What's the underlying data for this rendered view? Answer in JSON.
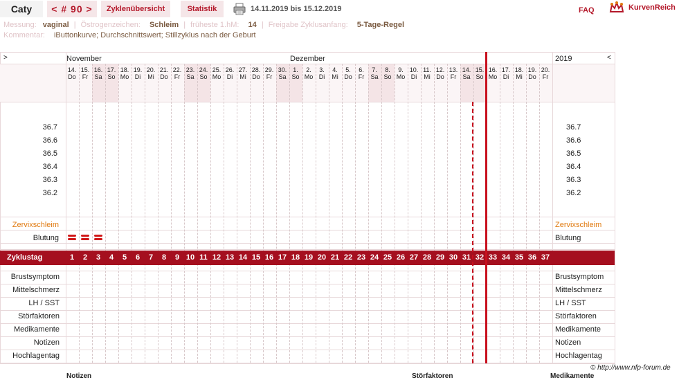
{
  "header": {
    "user_name": "Caty",
    "cycle_nav": "< # 90 >",
    "tab_overview": "Zyklenübersicht",
    "tab_stats": "Statistik",
    "date_range": "14.11.2019 bis 15.12.2019",
    "faq": "FAQ",
    "logo": "KurvenReich"
  },
  "info": {
    "messung_label": "Messung:",
    "messung_value": "vaginal",
    "oestrogen_label": "Östrogenzeichen:",
    "oestrogen_value": "Schleim",
    "fruehste_label": "früheste 1.hM:",
    "fruehste_value": "14",
    "freigabe_label": "Freigabe Zyklusanfang:",
    "freigabe_value": "5-Tage-Regel",
    "kommentar_label": "Kommentar:",
    "kommentar_value": "iButtonkurve; Durchschnittswert; Stillzyklus nach der Geburt"
  },
  "chart": {
    "nav_left": ">",
    "nav_right": "<",
    "month_nov": "November",
    "month_dez": "Dezember",
    "year": "2019",
    "days": [
      {
        "d": "14.",
        "w": "Do"
      },
      {
        "d": "15.",
        "w": "Fr"
      },
      {
        "d": "16.",
        "w": "Sa"
      },
      {
        "d": "17.",
        "w": "So"
      },
      {
        "d": "18.",
        "w": "Mo"
      },
      {
        "d": "19.",
        "w": "Di"
      },
      {
        "d": "20.",
        "w": "Mi"
      },
      {
        "d": "21.",
        "w": "Do"
      },
      {
        "d": "22.",
        "w": "Fr"
      },
      {
        "d": "23.",
        "w": "Sa"
      },
      {
        "d": "24.",
        "w": "So"
      },
      {
        "d": "25.",
        "w": "Mo"
      },
      {
        "d": "26.",
        "w": "Di"
      },
      {
        "d": "27.",
        "w": "Mi"
      },
      {
        "d": "28.",
        "w": "Do"
      },
      {
        "d": "29.",
        "w": "Fr"
      },
      {
        "d": "30.",
        "w": "Sa"
      },
      {
        "d": "1.",
        "w": "So"
      },
      {
        "d": "2.",
        "w": "Mo"
      },
      {
        "d": "3.",
        "w": "Di"
      },
      {
        "d": "4.",
        "w": "Mi"
      },
      {
        "d": "5.",
        "w": "Do"
      },
      {
        "d": "6.",
        "w": "Fr"
      },
      {
        "d": "7.",
        "w": "Sa"
      },
      {
        "d": "8.",
        "w": "So"
      },
      {
        "d": "9.",
        "w": "Mo"
      },
      {
        "d": "10.",
        "w": "Di"
      },
      {
        "d": "11.",
        "w": "Mi"
      },
      {
        "d": "12.",
        "w": "Do"
      },
      {
        "d": "13.",
        "w": "Fr"
      },
      {
        "d": "14.",
        "w": "Sa"
      },
      {
        "d": "15.",
        "w": "So"
      },
      {
        "d": "16.",
        "w": "Mo"
      },
      {
        "d": "17.",
        "w": "Di"
      },
      {
        "d": "18.",
        "w": "Mi"
      },
      {
        "d": "19.",
        "w": "Do"
      },
      {
        "d": "20.",
        "w": "Fr"
      }
    ],
    "temperatures": [
      "36.7",
      "36.6",
      "36.5",
      "36.4",
      "36.3",
      "36.2"
    ],
    "zervix_label": "Zervixschleim",
    "blutung_label": "Blutung",
    "blutung_days": [
      1,
      2,
      3
    ],
    "zyklustag_label": "Zyklustag",
    "cycle_days": [
      "1",
      "2",
      "3",
      "4",
      "5",
      "6",
      "7",
      "8",
      "9",
      "10",
      "11",
      "12",
      "13",
      "14",
      "15",
      "16",
      "17",
      "18",
      "19",
      "20",
      "21",
      "22",
      "23",
      "24",
      "25",
      "26",
      "27",
      "28",
      "29",
      "30",
      "31",
      "32",
      "33",
      "34",
      "35",
      "36",
      "37"
    ],
    "symptom_rows": [
      "Brustsymptom",
      "Mittelschmerz",
      "LH / SST",
      "Störfaktoren",
      "Medikamente",
      "Notizen",
      "Hochlagentag"
    ],
    "colors": {
      "accent": "#a50f1f",
      "weekend": "#f4e4e6",
      "zervix": "#e07a10",
      "bleeding": "#d01818"
    }
  },
  "footer": {
    "copyright": "© http://www.nfp-forum.de",
    "col_notizen": "Notizen",
    "col_stoerfaktoren": "Störfaktoren",
    "col_medikamente": "Medikamente"
  }
}
